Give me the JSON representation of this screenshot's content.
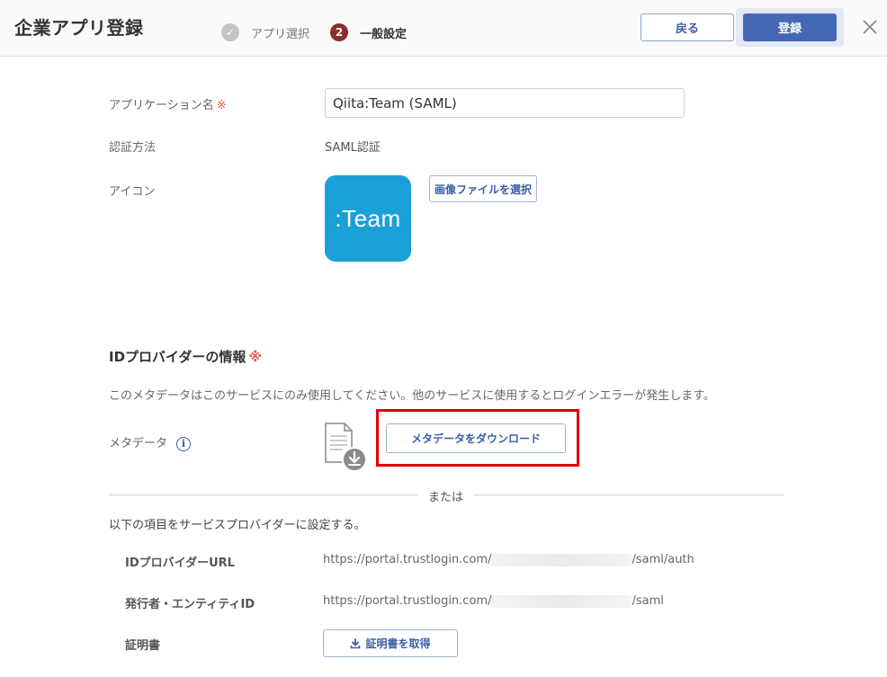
{
  "header": {
    "title": "企業アプリ登録",
    "steps": [
      {
        "number": "✓",
        "label": "アプリ選択"
      },
      {
        "number": "2",
        "label": "一般設定"
      }
    ],
    "back_label": "戻る",
    "register_label": "登録"
  },
  "form": {
    "app_name_label": "アプリケーション名",
    "required_mark": "※",
    "app_name_value": "Qiita:Team (SAML)",
    "auth_method_label": "認証方法",
    "auth_method_value": "SAML認証",
    "icon_label": "アイコン",
    "icon_text": ":Team",
    "select_image_label": "画像ファイルを選択"
  },
  "idp": {
    "section_title": "IDプロバイダーの情報",
    "required_mark": "※",
    "notice": "このメタデータはこのサービスにのみ使用してください。他のサービスに使用するとログインエラーが発生します。",
    "metadata_label": "メタデータ",
    "info_glyph": "i",
    "download_label": "メタデータをダウンロード",
    "or_text": "または",
    "sp_note": "以下の項目をサービスプロバイダーに設定する。",
    "idp_url_label": "IDプロバイダーURL",
    "idp_url_prefix": "https://portal.trustlogin.com/",
    "idp_url_suffix": "/saml/auth",
    "issuer_label": "発行者・エンティティID",
    "issuer_prefix": "https://portal.trustlogin.com/",
    "issuer_suffix": "/saml",
    "cert_label": "証明書",
    "cert_button_label": "証明書を取得"
  },
  "colors": {
    "accent": "#4468b3",
    "step_active": "#8b2e2e",
    "highlight": "#e00000",
    "app_icon_bg": "#1ca0d8"
  }
}
